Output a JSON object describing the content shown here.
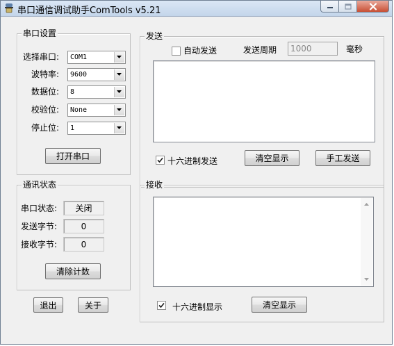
{
  "window": {
    "title": "串口通信调试助手ComTools v5.21"
  },
  "serial_settings": {
    "title": "串口设置",
    "port": {
      "label": "选择串口:",
      "value": "COM1"
    },
    "baud": {
      "label": "波特率:",
      "value": "9600"
    },
    "data_bits": {
      "label": "数据位:",
      "value": "8"
    },
    "parity": {
      "label": "校验位:",
      "value": "None"
    },
    "stop_bits": {
      "label": "停止位:",
      "value": "1"
    },
    "open_button": "打开串口"
  },
  "status": {
    "title": "通讯状态",
    "port_status": {
      "label": "串口状态:",
      "value": "关闭"
    },
    "sent_bytes": {
      "label": "发送字节:",
      "value": "0"
    },
    "recv_bytes": {
      "label": "接收字节:",
      "value": "0"
    },
    "clear_button": "清除计数"
  },
  "bottom_buttons": {
    "exit": "退出",
    "about": "关于"
  },
  "send": {
    "title": "发送",
    "auto_send": {
      "label": "自动发送",
      "checked": false
    },
    "period_label": "发送周期",
    "period_value": "1000",
    "period_unit": "毫秒",
    "text": "",
    "hex_send": {
      "label": "十六进制发送",
      "checked": true
    },
    "clear_button": "清空显示",
    "manual_send_button": "手工发送"
  },
  "receive": {
    "title": "接收",
    "text": "",
    "hex_display": {
      "label": "十六进制显示",
      "checked": true
    },
    "clear_button": "清空显示"
  }
}
